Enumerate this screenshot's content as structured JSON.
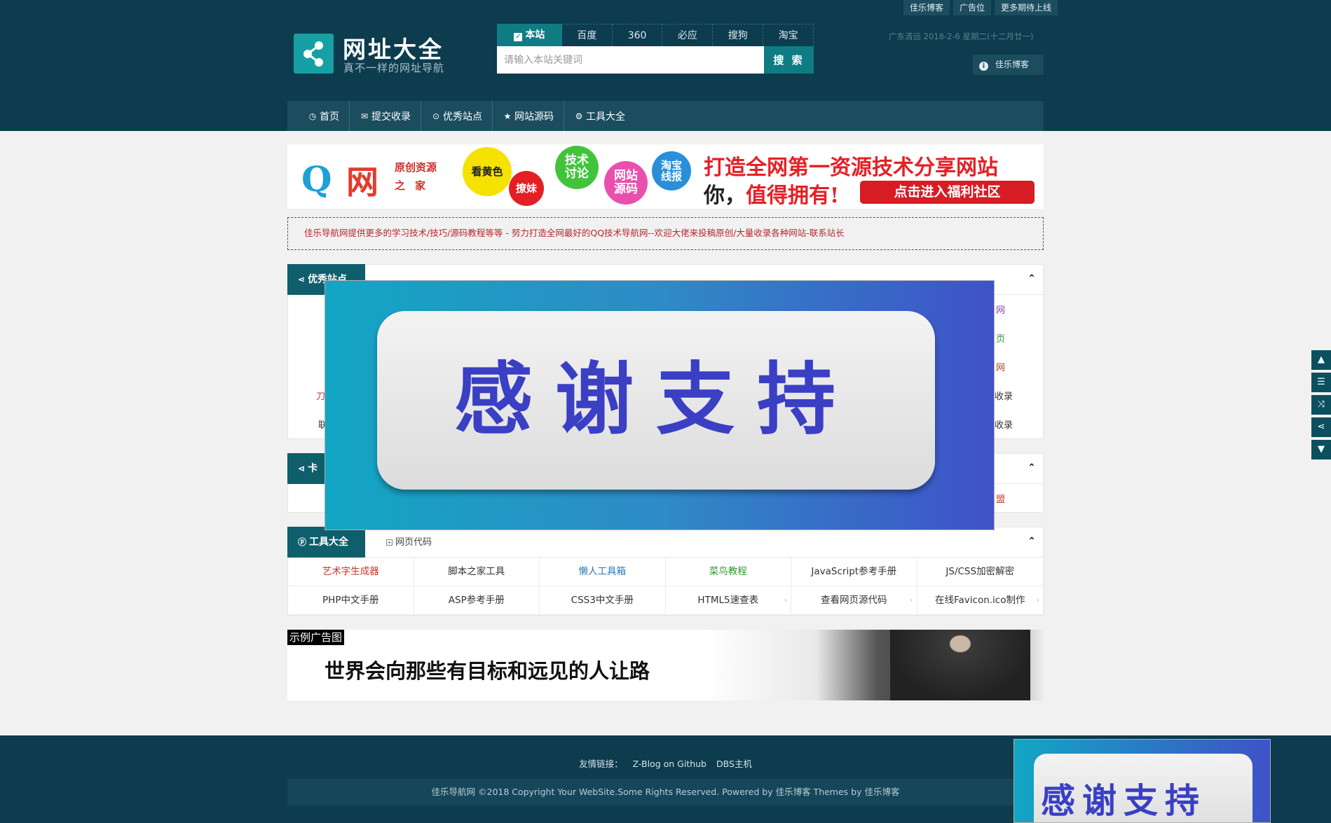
{
  "top_links": [
    "佳乐博客",
    "广告位",
    "更多期待上线"
  ],
  "logo": {
    "title": "网址大全",
    "subtitle": "真不一样的网址导航"
  },
  "search": {
    "tabs": [
      "本站",
      "百度",
      "360",
      "必应",
      "搜狗",
      "淘宝"
    ],
    "active_tab": "本站",
    "placeholder": "请输入本站关键词",
    "button": "搜 索"
  },
  "date_text": "广东清远   2018-2-6  星期二(十二月廿一)",
  "info_button": "佳乐博客",
  "nav": [
    {
      "label": "首页",
      "icon": "clock-icon"
    },
    {
      "label": "提交收录",
      "icon": "envelope-icon"
    },
    {
      "label": "优秀站点",
      "icon": "chevron-circle-icon"
    },
    {
      "label": "网站源码",
      "icon": "star-icon"
    },
    {
      "label": "工具大全",
      "icon": "gear-icon"
    }
  ],
  "banner1": {
    "logo_q": "Q",
    "logo_wang": "网",
    "logo_sub1": "原创资源",
    "logo_sub2": "之家",
    "bubbles": [
      "看黄色",
      "撩妹",
      "技术讨论",
      "网站源码",
      "淘宝线报"
    ],
    "slogan1": "打造全网第一资源技术分享网站",
    "slogan2_you": "你，",
    "slogan2_rest": "值得拥有!",
    "cta": "点击进入福利社区"
  },
  "notice": "佳乐导航网提供更多的学习技术/技巧/源码教程等等 - 努力打造全网最好的QQ技术导航网--欢迎大佬来投稿原创/大量收录各种网站-联系站长",
  "panels": {
    "youxiu": {
      "title": "优秀站点",
      "edge_left": [
        "刀",
        "联"
      ],
      "edge_right": [
        "网",
        "页",
        "网",
        "收录",
        "收录"
      ]
    },
    "kami": {
      "title": "卡",
      "edge_right": "盟"
    },
    "tools": {
      "title": "工具大全",
      "subtab": "网页代码",
      "rows": [
        [
          {
            "label": "艺术字生成器",
            "color": "#c0392b"
          },
          {
            "label": "脚本之家工具",
            "color": "#333333"
          },
          {
            "label": "懒人工具箱",
            "color": "#2f78b4"
          },
          {
            "label": "菜鸟教程",
            "color": "#2d9b2d"
          },
          {
            "label": "JavaScript参考手册",
            "color": "#333333"
          },
          {
            "label": "JS/CSS加密解密",
            "color": "#333333"
          }
        ],
        [
          {
            "label": "PHP中文手册",
            "color": "#333333"
          },
          {
            "label": "ASP参考手册",
            "color": "#333333"
          },
          {
            "label": "CSS3中文手册",
            "color": "#333333"
          },
          {
            "label": "HTML5速查表",
            "color": "#333333"
          },
          {
            "label": "查看网页源代码",
            "color": "#333333"
          },
          {
            "label": "在线Favicon.ico制作",
            "color": "#333333"
          }
        ]
      ]
    }
  },
  "ad2": {
    "label": "示例广告图",
    "text": "世界会向那些有目标和远见的人让路"
  },
  "popup": {
    "text": "感谢支持"
  },
  "side_tools": [
    "top-icon",
    "list-icon",
    "shuffle-icon",
    "share-icon",
    "bottom-icon"
  ],
  "footer": {
    "friends_label": "友情链接：",
    "friends": [
      "Z-Blog on Github",
      "DBS主机"
    ],
    "copyright": "佳乐导航网 ©2018 Copyright Your WebSite.Some Rights Reserved. Powered by 佳乐博客 Themes by 佳乐博客"
  },
  "colors": {
    "header_bg": "#0c3c4e",
    "accent": "#0f7c84",
    "panel_tab": "#0f5e6b",
    "notice_text": "#b5282e"
  }
}
